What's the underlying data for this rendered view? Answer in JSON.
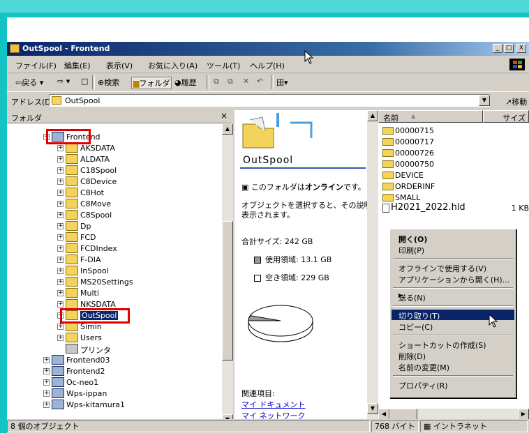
{
  "window": {
    "title": "OutSpool - Frontend",
    "buttons": [
      "_",
      "□",
      "X"
    ]
  },
  "menubar": [
    "ファイル(F)",
    "編集(E)",
    "表示(V)",
    "お気に入り(A)",
    "ツール(T)",
    "ヘルプ(H)"
  ],
  "toolbar": {
    "back": "⇦戻る",
    "forward": "⇨",
    "up": "□",
    "search": "検索",
    "folders": "フォルダ",
    "history": "履歴",
    "views": "田"
  },
  "address": {
    "label": "アドレス(D)",
    "value": "OutSpool",
    "go": "移動"
  },
  "folder_pane": {
    "title": "フォルダ",
    "close": "×",
    "items": [
      {
        "label": "Frontend",
        "icon": "computer-icon"
      },
      {
        "label": "AKSDATA",
        "icon": "folder-icon"
      },
      {
        "label": "ALDATA",
        "icon": "folder-icon"
      },
      {
        "label": "C18Spool",
        "icon": "folder-icon"
      },
      {
        "label": "C8Device",
        "icon": "folder-icon"
      },
      {
        "label": "C8Hot",
        "icon": "folder-icon"
      },
      {
        "label": "C8Move",
        "icon": "folder-icon"
      },
      {
        "label": "C8Spool",
        "icon": "folder-icon"
      },
      {
        "label": "Dp",
        "icon": "folder-icon"
      },
      {
        "label": "FCD",
        "icon": "folder-icon"
      },
      {
        "label": "FCDIndex",
        "icon": "folder-icon"
      },
      {
        "label": "F-DIA",
        "icon": "folder-icon"
      },
      {
        "label": "InSpool",
        "icon": "folder-icon"
      },
      {
        "label": "MS20Settings",
        "icon": "folder-icon"
      },
      {
        "label": "Multi",
        "icon": "folder-icon"
      },
      {
        "label": "NKSDATA",
        "icon": "folder-icon"
      },
      {
        "label": "OutSpool",
        "icon": "folder-icon"
      },
      {
        "label": "Simin",
        "icon": "folder-icon"
      },
      {
        "label": "Users",
        "icon": "folder-icon"
      },
      {
        "label": "プリンタ",
        "icon": "printer-icon"
      },
      {
        "label": "Frontend03",
        "icon": "computer-icon"
      },
      {
        "label": "Frontend2",
        "icon": "computer-icon"
      },
      {
        "label": "Oc-neo1",
        "icon": "computer-icon"
      },
      {
        "label": "Wps-ippan",
        "icon": "computer-icon"
      },
      {
        "label": "Wps-kitamura1",
        "icon": "computer-icon"
      }
    ]
  },
  "info_pane": {
    "folder_name": "OutSpool",
    "online": "このフォルダはオンラインです。",
    "online_prefix": "このフォルダは",
    "online_bold": "オンライン",
    "online_suffix": "です。",
    "hint": "オブジェクトを選択すると、その説明が表示されます。",
    "hint_line1": "オブジェクトを選択すると、その説明が",
    "hint_line2": "表示されます。",
    "total_size": "合計サイズ: 242 GB",
    "used": "使用領域: 13.1 GB",
    "free": "空き領域: 229 GB",
    "used_fraction": 0.054,
    "related_label": "関連項目:",
    "links": [
      "マイ ドキュメント",
      "マイ ネットワーク"
    ]
  },
  "file_list": {
    "columns": [
      "名前",
      "サイズ"
    ],
    "sort_indicator": "▲",
    "items": [
      {
        "name": "00000715",
        "icon": "folder-icon"
      },
      {
        "name": "00000717",
        "icon": "folder-icon"
      },
      {
        "name": "00000726",
        "icon": "folder-icon"
      },
      {
        "name": "00000750",
        "icon": "folder-icon"
      },
      {
        "name": "DEVICE",
        "icon": "folder-icon"
      },
      {
        "name": "ORDERINF",
        "icon": "folder-icon"
      },
      {
        "name": "SMALL",
        "icon": "folder-icon"
      },
      {
        "name": "H2021_2022.hld",
        "icon": "file-icon",
        "size": "1 KB"
      }
    ]
  },
  "context_menu": {
    "items": [
      {
        "label": "開く(O)",
        "bold": true
      },
      {
        "label": "印刷(P)"
      },
      {
        "label": "オフラインで使用する(V)"
      },
      {
        "label": "アプリケーションから開く(H)..."
      },
      {
        "label": "送る(N)",
        "submenu": true
      },
      {
        "label": "切り取り(T)",
        "highlighted": true
      },
      {
        "label": "コピー(C)"
      },
      {
        "label": "ショートカットの作成(S)"
      },
      {
        "label": "削除(D)"
      },
      {
        "label": "名前の変更(M)"
      },
      {
        "label": "プロパティ(R)"
      }
    ]
  },
  "status": {
    "objects": "8 個のオブジェクト",
    "size": "768 バイト",
    "zone": "イントラネット"
  },
  "colors": {
    "accent_teal": "#12c6c6",
    "title_bar": "#0a246a",
    "highlight_box": "#e00000"
  }
}
